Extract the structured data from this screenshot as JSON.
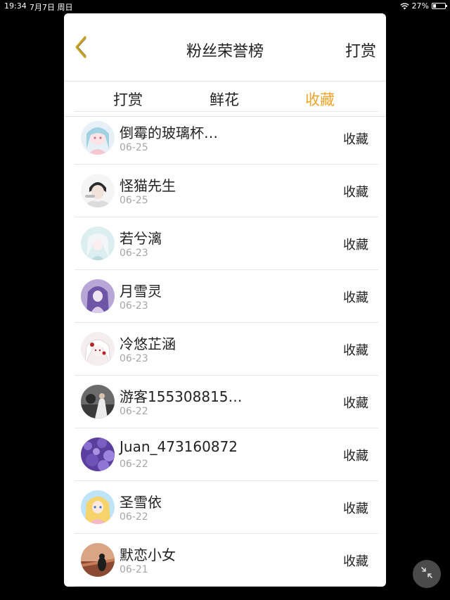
{
  "status_bar": {
    "time": "19:34",
    "date": "7月7日 周日",
    "battery": "27%",
    "battery_level": 0.27,
    "icons": [
      "wifi-icon",
      "battery-icon"
    ]
  },
  "nav": {
    "back_icon": "chevron-left-icon",
    "title": "粉丝荣誉榜",
    "right_label": "打赏"
  },
  "tabs": [
    {
      "label": "打赏",
      "active": false
    },
    {
      "label": "鲜花",
      "active": false
    },
    {
      "label": "收藏",
      "active": true
    }
  ],
  "colors": {
    "accent": "#f0a32a",
    "back_icon": "#c8a321",
    "date_text": "#a5a5a5",
    "overlay": "#000000"
  },
  "rows": [
    {
      "name": "倒霉的玻璃杯…",
      "date": "06-25",
      "action": "收藏"
    },
    {
      "name": "怪猫先生",
      "date": "06-25",
      "action": "收藏"
    },
    {
      "name": "若兮漓",
      "date": "06-23",
      "action": "收藏"
    },
    {
      "name": "月雪灵",
      "date": "06-23",
      "action": "收藏"
    },
    {
      "name": "冷悠芷涵",
      "date": "06-23",
      "action": "收藏"
    },
    {
      "name": "游客155308815…",
      "date": "06-22",
      "action": "收藏"
    },
    {
      "name": "Juan_473160872",
      "date": "06-22",
      "action": "收藏"
    },
    {
      "name": "圣雪依",
      "date": "06-22",
      "action": "收藏"
    },
    {
      "name": "默恋小女",
      "date": "06-21",
      "action": "收藏"
    }
  ],
  "float_button": {
    "icon": "collapse-arrows-icon"
  }
}
